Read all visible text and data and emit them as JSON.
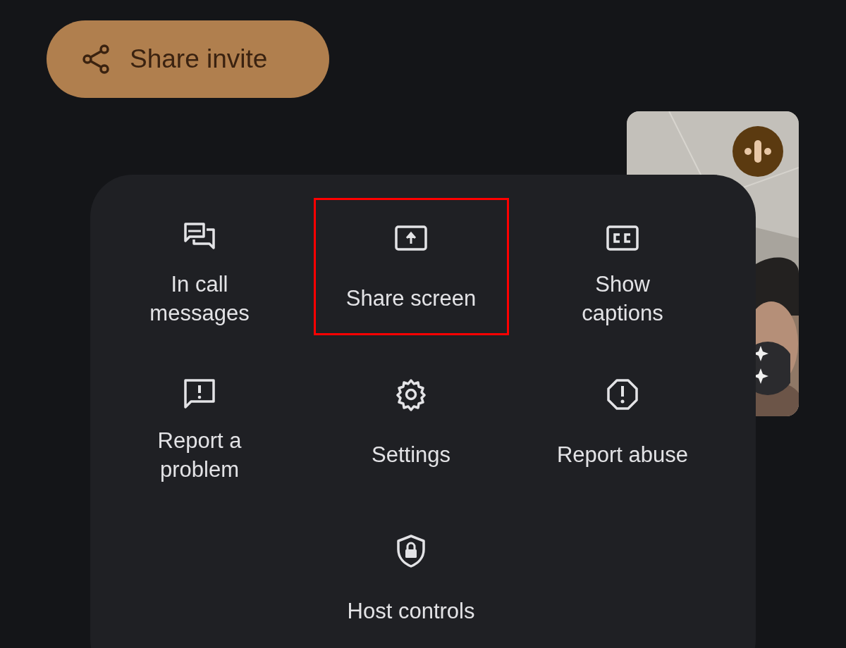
{
  "invite_button": {
    "label": "Share invite"
  },
  "menu": {
    "rows": [
      {
        "items": [
          {
            "label": "In call messages",
            "highlighted": false
          },
          {
            "label": "Share screen",
            "highlighted": true
          },
          {
            "label": "Show captions",
            "highlighted": false
          }
        ]
      },
      {
        "items": [
          {
            "label": "Report a problem",
            "highlighted": false
          },
          {
            "label": "Settings",
            "highlighted": false
          },
          {
            "label": "Report abuse",
            "highlighted": false
          }
        ]
      },
      {
        "items": [
          {
            "label": "Host controls",
            "highlighted": false
          }
        ]
      }
    ]
  }
}
